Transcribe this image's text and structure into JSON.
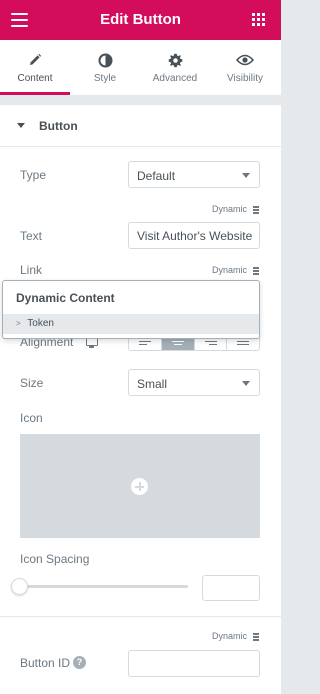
{
  "header": {
    "title": "Edit Button",
    "menu_icon": "hamburger-icon",
    "apps_icon": "grid-icon"
  },
  "tabs": [
    {
      "label": "Content",
      "icon": "pencil-icon",
      "active": true
    },
    {
      "label": "Style",
      "icon": "half-circle-icon",
      "active": false
    },
    {
      "label": "Advanced",
      "icon": "gear-icon",
      "active": false
    },
    {
      "label": "Visibility",
      "icon": "eye-icon",
      "active": false
    }
  ],
  "section": {
    "title": "Button"
  },
  "fields": {
    "type_label": "Type",
    "type_value": "Default",
    "dynamic_label": "Dynamic",
    "text_label": "Text",
    "text_value": "Visit Author's Website",
    "link_label": "Link",
    "alignment_label": "Alignment",
    "size_label": "Size",
    "size_value": "Small",
    "icon_label": "Icon",
    "icon_spacing_label": "Icon Spacing",
    "icon_spacing_value": "",
    "button_id_label": "Button ID",
    "button_id_value": "",
    "help_glyph": "?"
  },
  "popup": {
    "title": "Dynamic Content",
    "token_label": "Token",
    "token_chevron": ">"
  },
  "colors": {
    "brand": "#d30c5c",
    "text": "#6d7882",
    "text_dark": "#495157",
    "border": "#d5dadf",
    "bg": "#e6e9ec"
  }
}
